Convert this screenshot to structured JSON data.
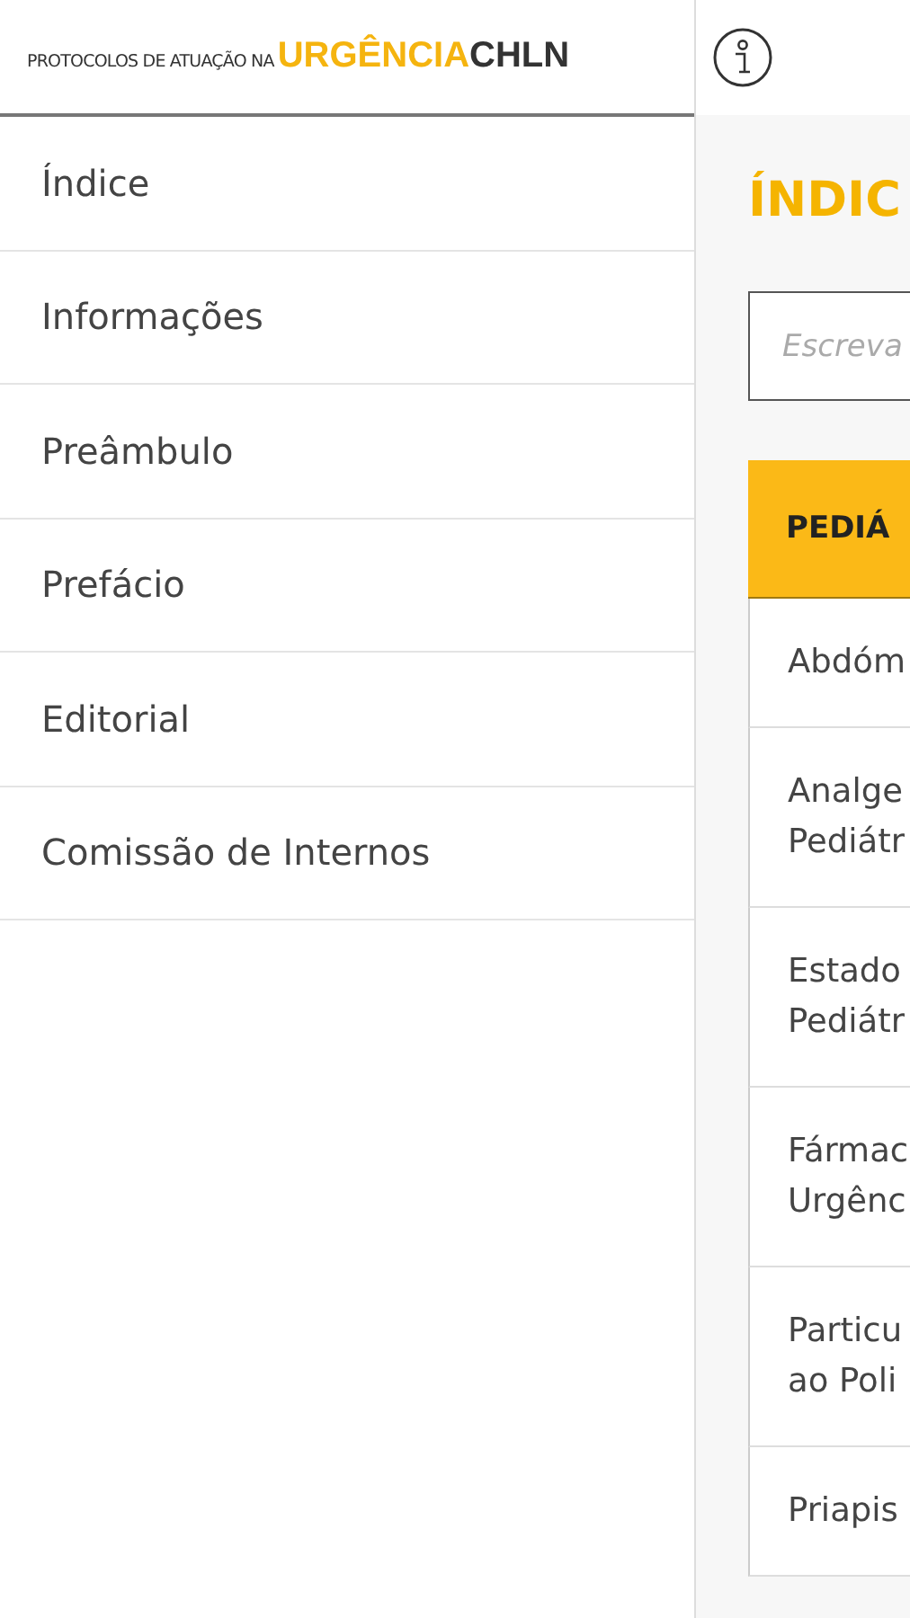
{
  "header": {
    "logo": {
      "prefix": "PROTOCOLOS DE ATUAÇÃO NA",
      "highlight": "URGÊNCIA",
      "suffix": "CHLN"
    }
  },
  "drawer": {
    "items": [
      {
        "label": "Índice"
      },
      {
        "label": "Informações"
      },
      {
        "label": "Preâmbulo"
      },
      {
        "label": "Prefácio"
      },
      {
        "label": "Editorial"
      },
      {
        "label": "Comissão de Internos"
      }
    ]
  },
  "content": {
    "title": "ÍNDIC",
    "search": {
      "placeholder": "Escreva"
    },
    "table": {
      "header": "PEDIÁ",
      "rows": [
        {
          "lines": [
            "Abdóm"
          ]
        },
        {
          "lines": [
            "Analge",
            "Pediátr"
          ]
        },
        {
          "lines": [
            "Estado",
            "Pediátr"
          ]
        },
        {
          "lines": [
            "Fármac",
            "Urgênc"
          ]
        },
        {
          "lines": [
            "Particu",
            "ao Poli"
          ]
        },
        {
          "lines": [
            "Priapis"
          ]
        }
      ]
    }
  }
}
